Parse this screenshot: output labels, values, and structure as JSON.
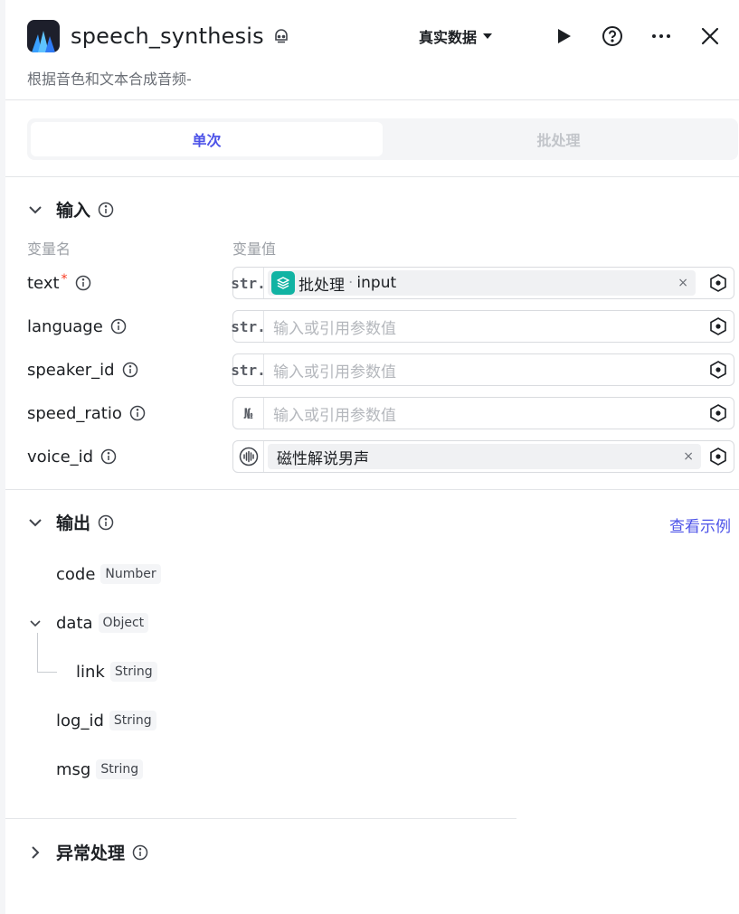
{
  "header": {
    "title": "speech_synthesis",
    "subtitle": "根据音色和文本合成音频-",
    "data_mode": "真实数据"
  },
  "tabs": [
    {
      "label": "单次",
      "active": true
    },
    {
      "label": "批处理",
      "active": false
    }
  ],
  "input": {
    "section_title": "输入",
    "col_name": "变量名",
    "col_value": "变量值",
    "params": [
      {
        "name": "text",
        "required": true,
        "type": "str.",
        "kind": "ref",
        "ref_source": "批处理",
        "ref_sep": "·",
        "ref_field": "input"
      },
      {
        "name": "language",
        "required": false,
        "type": "str.",
        "kind": "empty",
        "placeholder": "输入或引用参数值"
      },
      {
        "name": "speaker_id",
        "required": false,
        "type": "str.",
        "kind": "empty",
        "placeholder": "输入或引用参数值"
      },
      {
        "name": "speed_ratio",
        "required": false,
        "type": "№",
        "kind": "empty",
        "placeholder": "输入或引用参数值"
      },
      {
        "name": "voice_id",
        "required": false,
        "type": "voice",
        "kind": "voice",
        "value": "磁性解说男声"
      }
    ],
    "required_mark": "*",
    "clear_glyph": "×"
  },
  "output": {
    "section_title": "输出",
    "see_example": "查看示例",
    "items": [
      {
        "name": "code",
        "type": "Number"
      },
      {
        "name": "data",
        "type": "Object"
      },
      {
        "name": "link",
        "type": "String"
      },
      {
        "name": "log_id",
        "type": "String"
      },
      {
        "name": "msg",
        "type": "String"
      }
    ]
  },
  "exception": {
    "section_title": "异常处理"
  },
  "colors": {
    "accent": "#4d53e8",
    "ref_icon": "#11b3a3",
    "required": "#f93920"
  }
}
